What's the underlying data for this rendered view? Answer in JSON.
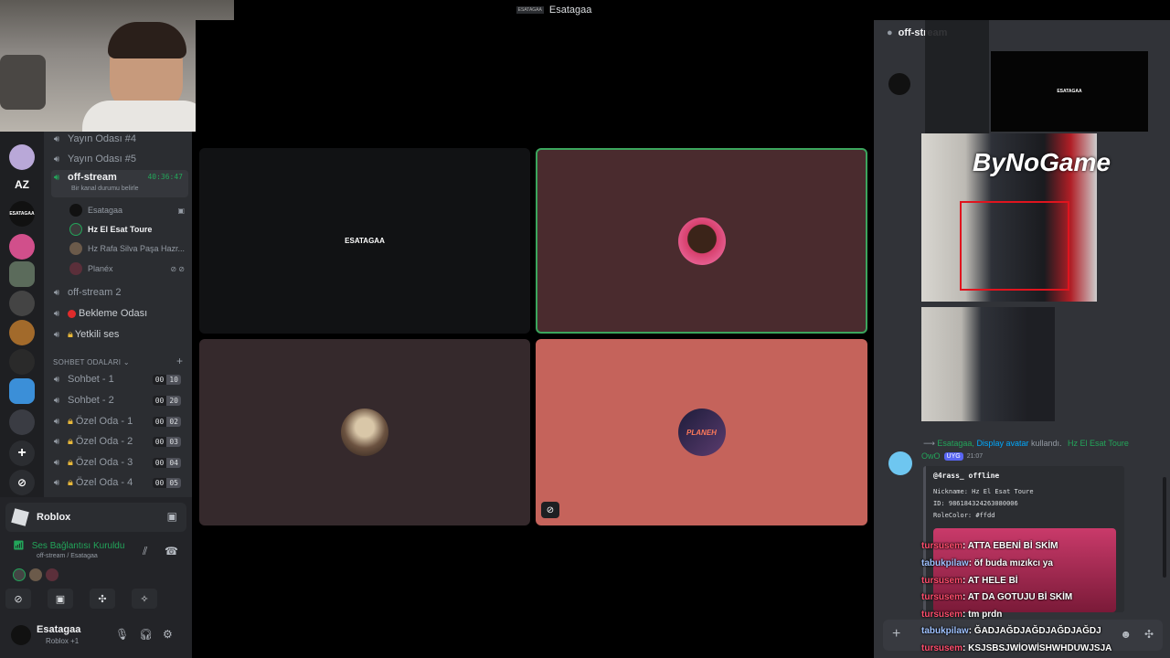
{
  "window": {
    "title": "Esatagaa",
    "badge": "ESATAGAA"
  },
  "rail": {
    "az_label": "AZ",
    "server_badge": "ESATAGAA"
  },
  "channels": {
    "items": [
      {
        "label": "Yayın Odası #4"
      },
      {
        "label": "Yayın Odası #5"
      },
      {
        "label": "off-stream",
        "timer": "40:36:47",
        "status": "Bir kanal durumu belirle"
      },
      {
        "label": "off-stream 2"
      },
      {
        "label": "Bekleme Odası"
      },
      {
        "label": "Yetkili ses"
      }
    ],
    "members": [
      {
        "name": "Esatagaa"
      },
      {
        "name": "Hz El Esat Toure"
      },
      {
        "name": "Hz Rafa Silva Paşa Hazr..."
      },
      {
        "name": "Planéx"
      }
    ],
    "category": "SOHBET ODALARI",
    "rooms": [
      {
        "label": "Sohbet - 1",
        "a": "00",
        "b": "10"
      },
      {
        "label": "Sohbet - 2",
        "a": "00",
        "b": "20"
      },
      {
        "label": "Özel Oda - 1",
        "a": "00",
        "b": "02"
      },
      {
        "label": "Özel Oda - 2",
        "a": "00",
        "b": "03"
      },
      {
        "label": "Özel Oda - 3",
        "a": "00",
        "b": "04"
      },
      {
        "label": "Özel Oda - 4",
        "a": "00",
        "b": "05"
      }
    ]
  },
  "activity": {
    "app": "Roblox"
  },
  "voice": {
    "status": "Ses Bağlantısı Kuruldu",
    "channel": "off-stream / Esatagaa"
  },
  "user": {
    "name": "Esatagaa",
    "status": "Roblox +1"
  },
  "stage": {
    "tile1_label": "ESATAGAA",
    "tile3_label": "PLANEH"
  },
  "chat": {
    "channel": "off-stream",
    "overlay_logo": "ByNoGame",
    "overlay_label": "ESATAGAA",
    "system": {
      "prefix": "Esatagaa, ",
      "link": "Display avatar",
      "mid": " kullandı.",
      "target": "Hz El Esat Toure"
    },
    "bot": {
      "name": "OwO",
      "tag": "UYG",
      "time": "21:07"
    },
    "embed": {
      "title": "@4rass_ offline",
      "lines": [
        "Nickname: Hz El Esat Toure",
        "ID: 986184324263080006",
        "RoleColor: #ffdd"
      ]
    },
    "stream_chat": [
      {
        "user": "tursusem",
        "text": ": ATTA EBENİ Bİ SKİM"
      },
      {
        "user": "tabukpilaw",
        "text": ": öf buda mızıkcı ya"
      },
      {
        "user": "tursusem",
        "text": ": AT HELE Bİ"
      },
      {
        "user": "tursusem",
        "text": ": AT DA GOTUJU Bİ SKİM"
      },
      {
        "user": "tursusem",
        "text": ": tm prdn"
      },
      {
        "user": "tabukpilaw",
        "text": ": ĞADJAĞDJAĞDJAĞDJAĞDJ"
      },
      {
        "user": "tursusem",
        "text": ": KSJSBSJWİOWİSHWHDUWJSJA"
      }
    ]
  },
  "colors": {
    "accent_green": "#23a55a",
    "tile_dark": "#111214",
    "tile_maroon": "#4a2b2e",
    "tile_salmon": "#c5635b"
  }
}
